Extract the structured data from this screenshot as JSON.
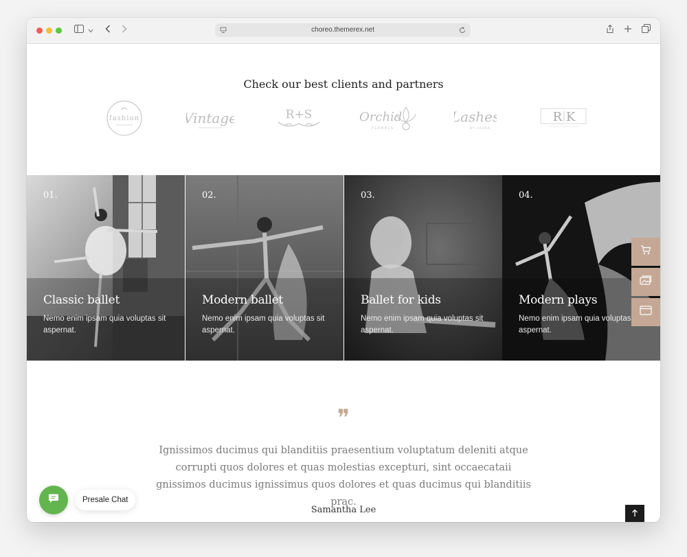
{
  "browser": {
    "url": "choreo.themerex.net"
  },
  "partners": {
    "title": "Check our best clients and partners",
    "logos": [
      {
        "name": "fashion",
        "text": "fashion"
      },
      {
        "name": "vintage",
        "text": "Vintage"
      },
      {
        "name": "rs",
        "text": "R+S"
      },
      {
        "name": "orchid",
        "text": "Orchid",
        "sub": "FLORALS"
      },
      {
        "name": "lashes",
        "text": "Lashes",
        "sub": "BY LAURA"
      },
      {
        "name": "rk",
        "text": "R  K"
      }
    ]
  },
  "classes": [
    {
      "num": "01.",
      "title": "Classic ballet",
      "desc": "Nemo enim ipsam quia voluptas sit aspernat."
    },
    {
      "num": "02.",
      "title": "Modern ballet",
      "desc": "Nemo enim ipsam quia voluptas sit aspernat."
    },
    {
      "num": "03.",
      "title": "Ballet for kids",
      "desc": "Nemo enim ipsam quia voluptas sit aspernat."
    },
    {
      "num": "04.",
      "title": "Modern plays",
      "desc": "Nemo enim ipsam quia voluptas sit aspernat."
    }
  ],
  "side_panel": {
    "icons": [
      "cart-icon",
      "image-stack-icon",
      "window-icon"
    ]
  },
  "testimonial": {
    "quote_mark": "❞",
    "text": "Ignissimos ducimus qui blanditiis praesentium voluptatum deleniti atque corrupti quos dolores et quas molestias excepturi, sint occaecataii gnissimos ducimus ignissimus quos dolores et quas ducimus qui blanditiis prac.",
    "author": "Samantha Lee"
  },
  "chat": {
    "label": "Presale Chat"
  },
  "colors": {
    "accent": "#c4a895",
    "chat_green": "#63b54f"
  }
}
